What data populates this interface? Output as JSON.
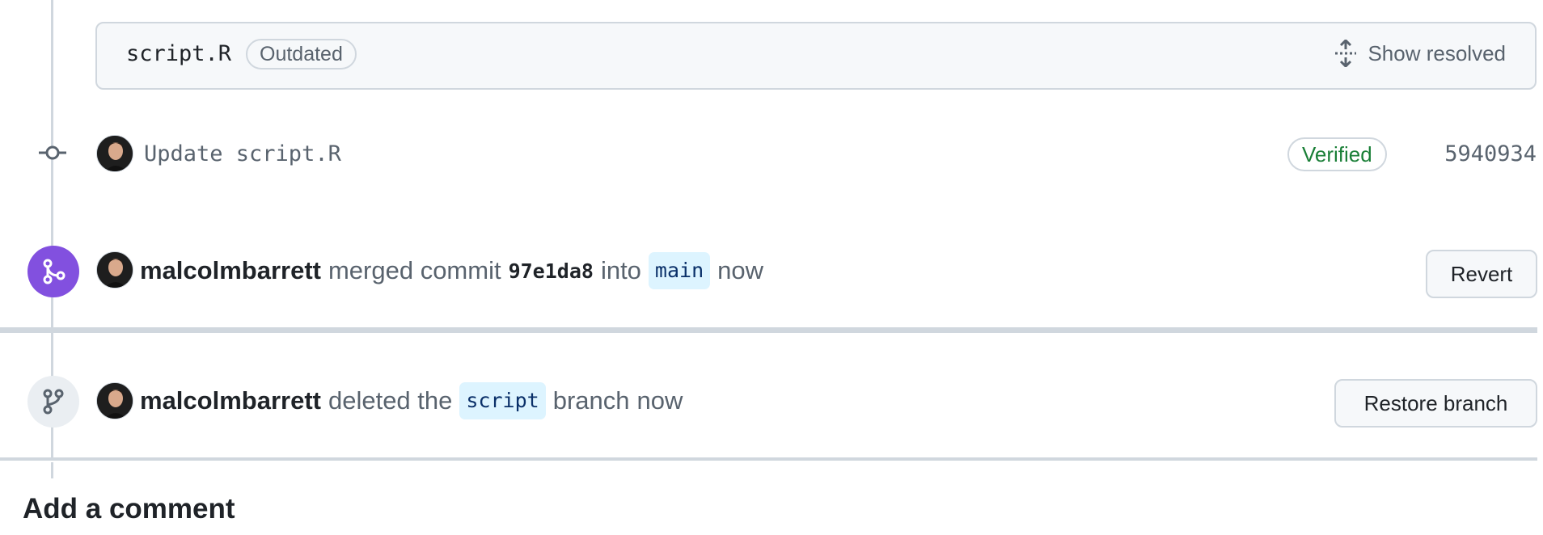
{
  "file_header": {
    "filename": "script.R",
    "badge": "Outdated",
    "show_resolved_label": "Show resolved",
    "icon": "unfold-icon"
  },
  "commit": {
    "message": "Update script.R",
    "verified_label": "Verified",
    "sha": "5940934",
    "icon": "git-commit-icon"
  },
  "merge_event": {
    "user": "malcolmbarrett",
    "verb": "merged commit",
    "commit_sha": "97e1da8",
    "into_word": "into",
    "branch": "main",
    "time": "now",
    "button_label": "Revert",
    "icon": "git-merge-icon",
    "icon_color": "#8250df"
  },
  "delete_event": {
    "user": "malcolmbarrett",
    "verb": "deleted the",
    "branch": "script",
    "branch_word": "branch",
    "time": "now",
    "button_label": "Restore branch",
    "icon": "git-branch-icon"
  },
  "comment_section": {
    "heading": "Add a comment"
  },
  "colors": {
    "border": "#d0d7de",
    "muted": "#59636e",
    "verified": "#1a7f37",
    "merge_purple": "#8250df",
    "branch_chip_bg": "#ddf4ff"
  }
}
